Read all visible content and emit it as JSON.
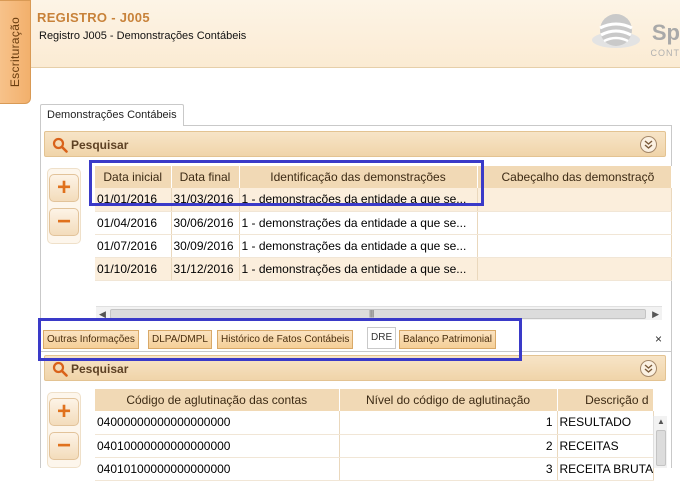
{
  "side_tab": {
    "label": "Escrituração"
  },
  "header": {
    "title": "REGISTRO - J005",
    "subtitle": "Registro J005 - Demonstrações Contábeis",
    "logo_text": "Sp",
    "logo_sub": "CONT"
  },
  "outer_tab": {
    "label": "Demonstrações Contábeis"
  },
  "search1": {
    "label": "Pesquisar"
  },
  "search2": {
    "label": "Pesquisar"
  },
  "buttons": {
    "add": "+",
    "remove": "−"
  },
  "table1": {
    "columns": [
      "Data inicial",
      "Data final",
      "Identificação das demonstrações",
      "Cabeçalho das demonstraçõ"
    ],
    "rows": [
      [
        "01/01/2016",
        "31/03/2016",
        "1 - demonstrações da entidade a que se...",
        ""
      ],
      [
        "01/04/2016",
        "30/06/2016",
        "1 - demonstrações da entidade a que se...",
        ""
      ],
      [
        "01/07/2016",
        "30/09/2016",
        "1 - demonstrações da entidade a que se...",
        ""
      ],
      [
        "01/10/2016",
        "31/12/2016",
        "1 - demonstrações da entidade a que se...",
        ""
      ]
    ]
  },
  "inner_tabs": [
    {
      "label": "Outras Informações"
    },
    {
      "label": "DLPA/DMPL"
    },
    {
      "label": "Histórico de Fatos Contábeis"
    },
    {
      "label": "DRE"
    },
    {
      "label": "Balanço Patrimonial"
    }
  ],
  "close_label": "×",
  "table2": {
    "columns": [
      "Código de aglutinação das contas",
      "Nível do código de aglutinação",
      "Descrição d"
    ],
    "rows": [
      [
        "04000000000000000000",
        "1",
        "RESULTADO"
      ],
      [
        "04010000000000000000",
        "2",
        "RECEITAS"
      ],
      [
        "04010100000000000000",
        "3",
        "RECEITA BRUTA"
      ]
    ]
  },
  "colors": {
    "accent": "#e0711d",
    "title": "#c8823a",
    "highlight": "#3a3ac8",
    "header_bg": "#f1d9b5"
  }
}
